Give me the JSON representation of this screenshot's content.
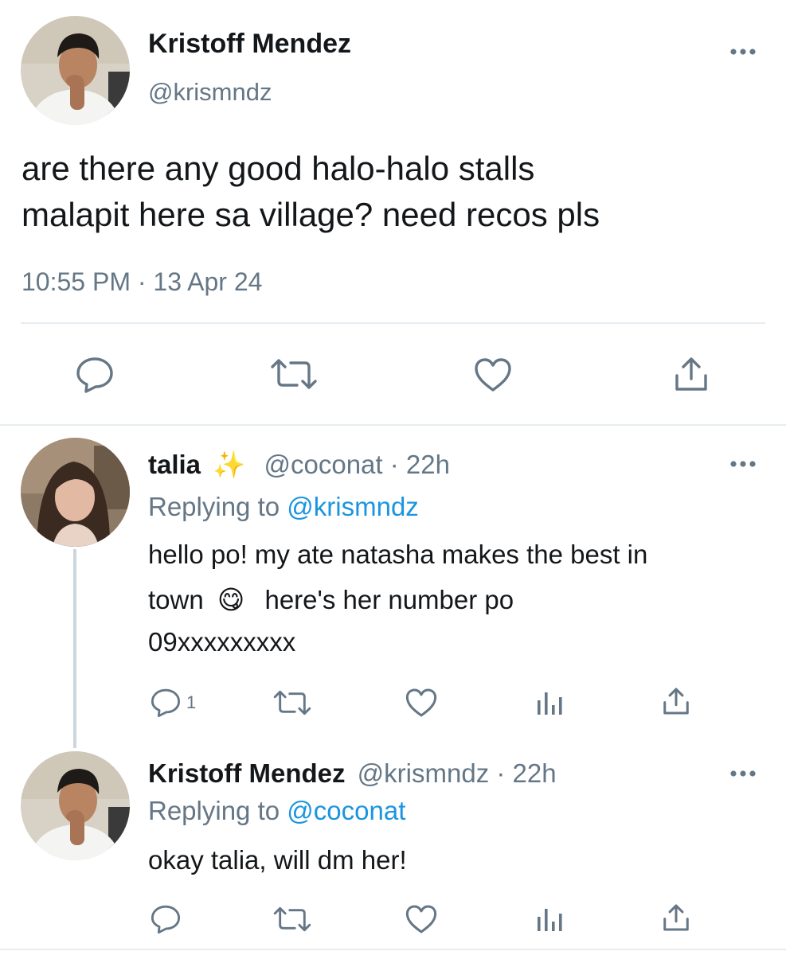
{
  "main_tweet": {
    "name": "Kristoff Mendez",
    "handle": "@krismndz",
    "text_line1": "are there any good halo-halo stalls",
    "text_line2": "malapit here sa village? need recos pls",
    "time": "10:55 PM",
    "separator": "·",
    "date": "13 Apr 24",
    "icons": [
      "reply-icon",
      "retweet-icon",
      "like-icon",
      "share-icon",
      "more-icon"
    ]
  },
  "reply1": {
    "name": "talia",
    "name_emoji": "✨",
    "handle_time": "@coconat · 22h",
    "replying_prefix": "Replying to",
    "replying_handle": "@krismndz",
    "text_line1": "hello po! my ate natasha makes the best in",
    "text_line2a": "town",
    "emoji": "😋",
    "text_line2b": "here's her number po",
    "text_line3": "09xxxxxxxxx",
    "reply_count": "1",
    "icons": [
      "reply-icon",
      "retweet-icon",
      "like-icon",
      "analytics-icon",
      "share-icon",
      "more-icon"
    ]
  },
  "reply2": {
    "name": "Kristoff Mendez",
    "handle_time": "@krismndz · 22h",
    "replying_prefix": "Replying to",
    "replying_handle": "@coconat",
    "text": "okay talia, will dm her!",
    "icons": [
      "reply-icon",
      "retweet-icon",
      "like-icon",
      "analytics-icon",
      "share-icon",
      "more-icon"
    ]
  },
  "colors": {
    "text": "#14171a",
    "muted": "#657786",
    "link": "#1b95e0",
    "divider": "#e6ecf0"
  }
}
